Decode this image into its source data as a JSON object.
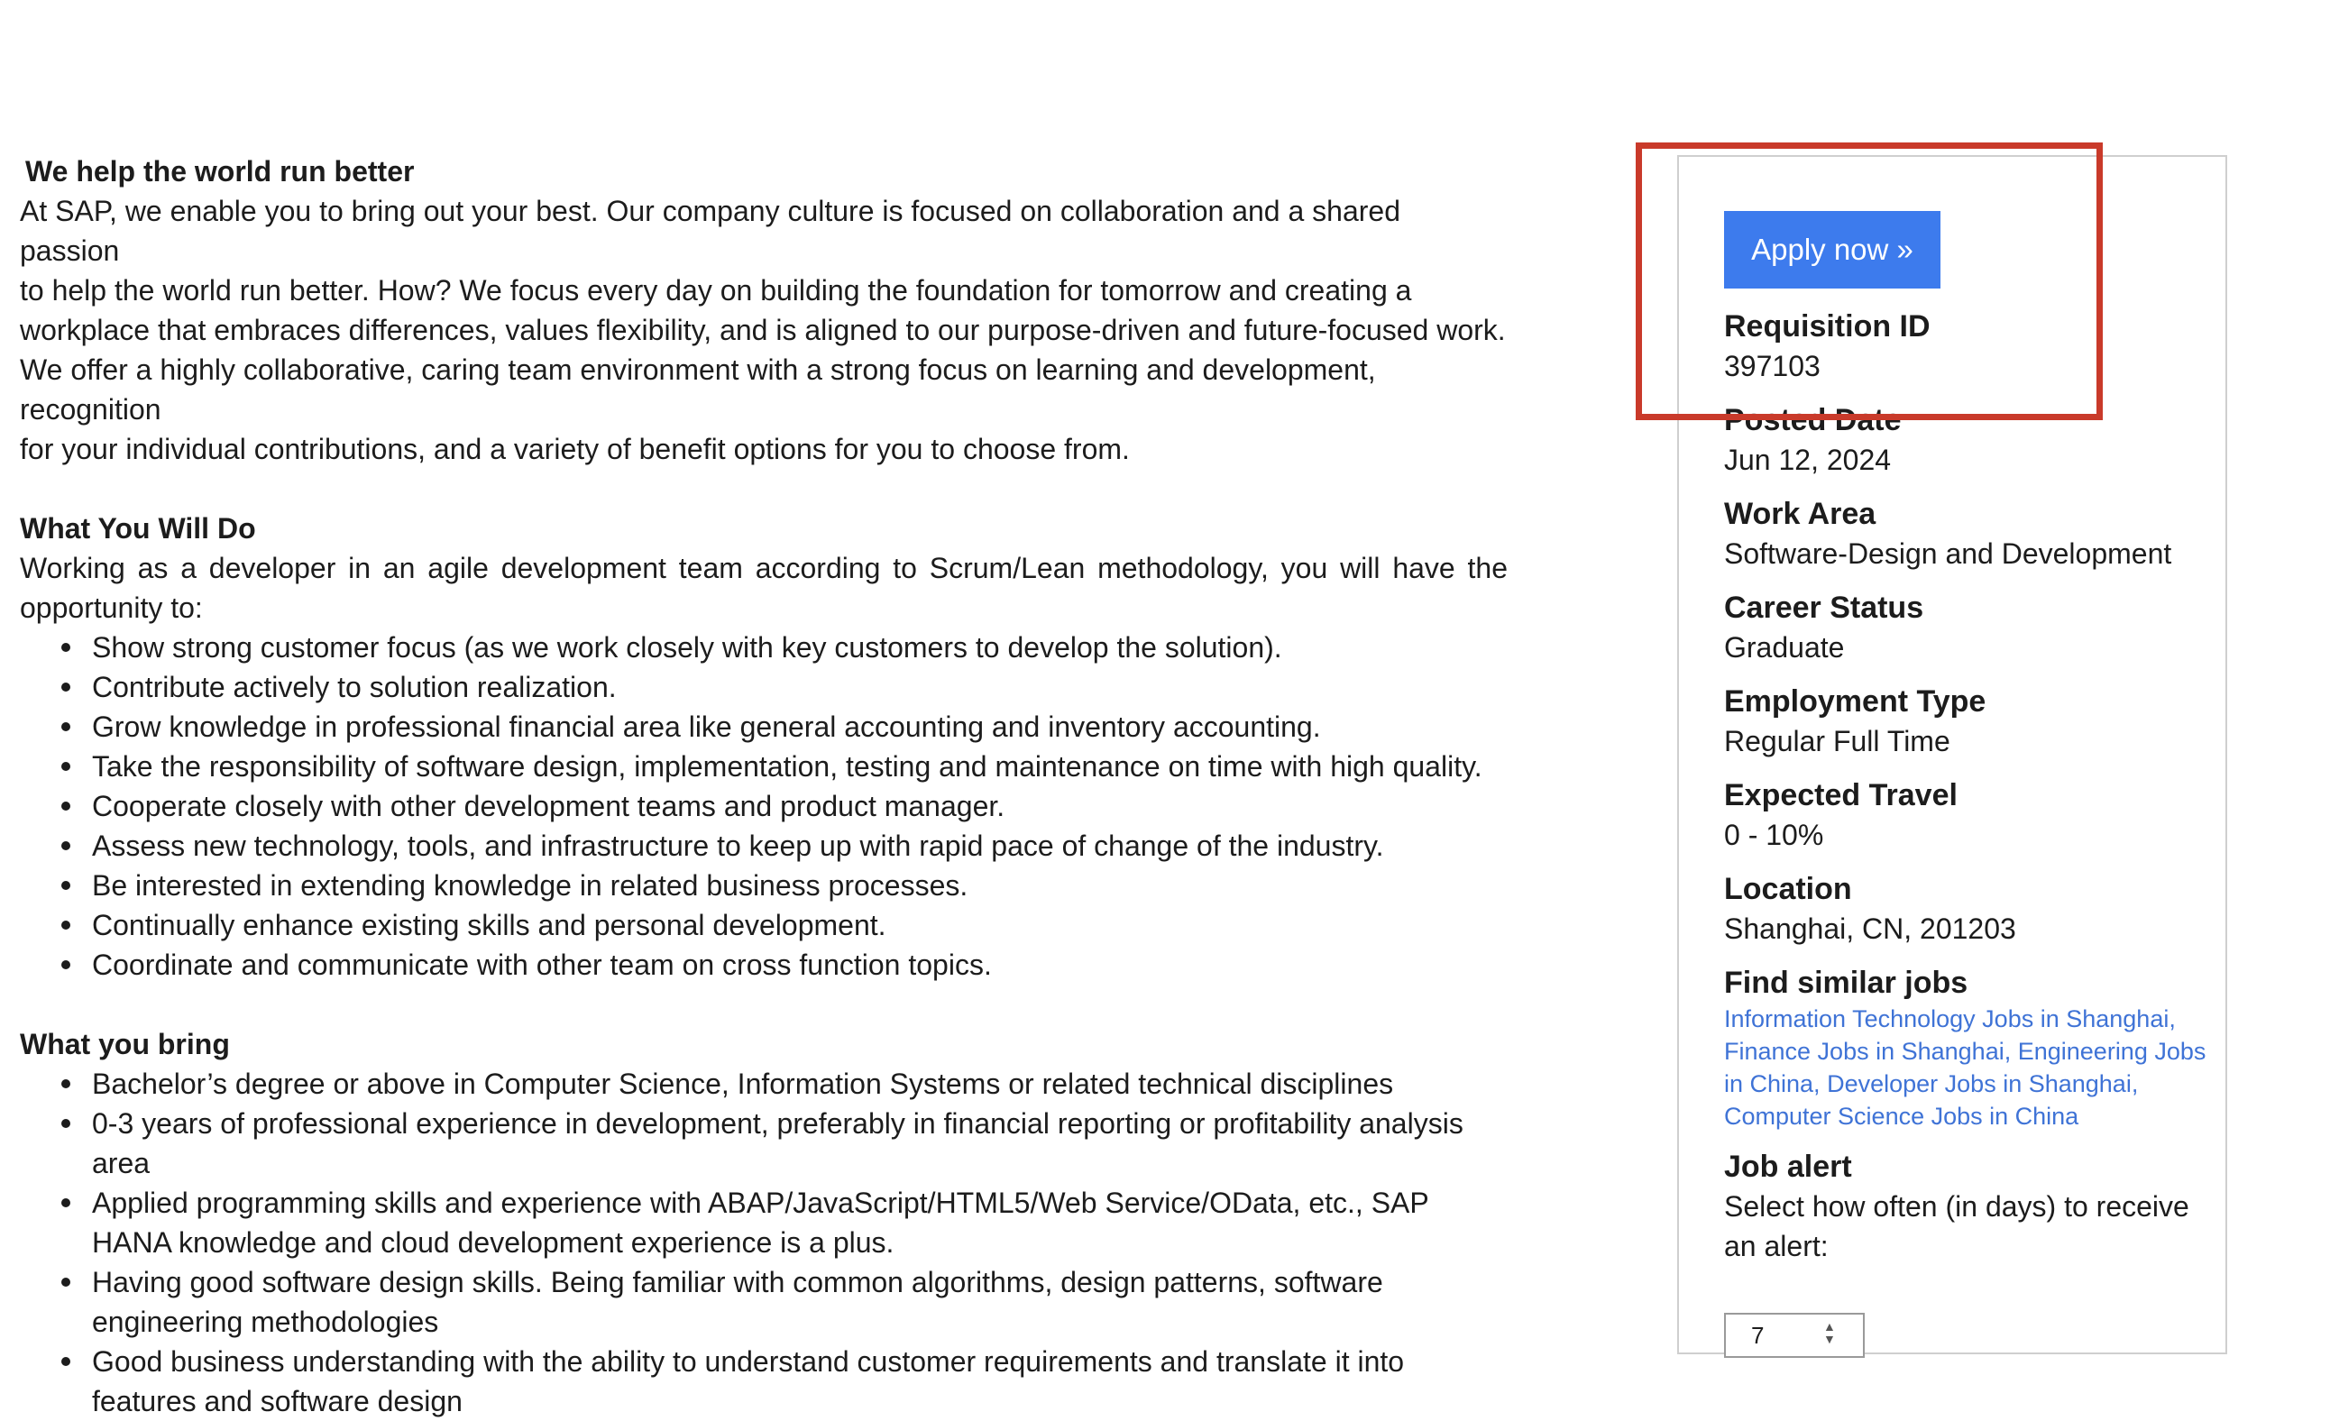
{
  "intro": {
    "heading": "We help the world run better",
    "lines": [
      "At SAP, we enable you to bring out your best. Our company culture is focused on collaboration and a shared passion",
      "to help the world run better. How? We focus every day on building the foundation for tomorrow and creating a",
      "workplace that embraces differences, values flexibility, and is aligned to our purpose-driven and future-focused work.",
      "We offer a highly collaborative, caring team environment with a strong focus on learning and development, recognition",
      "for your individual contributions, and a variety of benefit options for you to choose from."
    ]
  },
  "what_you_do": {
    "heading": "What You Will Do",
    "intro": "Working as a developer in an agile development team according to Scrum/Lean methodology, you will have the opportunity to:",
    "items": [
      "Show strong customer focus (as we work closely with key customers to develop the solution).",
      "Contribute actively to solution realization.",
      "Grow knowledge in professional financial area like general accounting and inventory accounting.",
      "Take the responsibility of software design, implementation, testing and maintenance on time with high quality.",
      "Cooperate closely with other development teams and product manager.",
      "Assess new technology, tools, and infrastructure to keep up with rapid pace of change of the industry.",
      "Be interested in extending knowledge in related business processes.",
      "Continually enhance existing skills and personal development.",
      "Coordinate and communicate with other team on cross function topics."
    ]
  },
  "what_you_bring": {
    "heading": "What you bring",
    "items": [
      "Bachelor’s degree or above in Computer Science, Information Systems or related technical disciplines",
      "0-3 years of professional experience in development, preferably in financial reporting or profitability analysis area",
      "Applied programming skills and experience with ABAP/JavaScript/HTML5/Web Service/OData, etc., SAP HANA knowledge and cloud development experience is a plus.",
      "Having good software design skills. Being familiar with common algorithms, design patterns, software engineering methodologies",
      "Good business understanding with the ability to understand customer requirements and translate it into features and software design"
    ]
  },
  "sidebar": {
    "apply_label": "Apply now »",
    "fields": [
      {
        "label": "Requisition ID",
        "value": "397103"
      },
      {
        "label": "Posted Date",
        "value": "Jun 12, 2024"
      },
      {
        "label": "Work Area",
        "value": "Software-Design and Development"
      },
      {
        "label": "Career Status",
        "value": "Graduate"
      },
      {
        "label": "Employment Type",
        "value": "Regular Full Time"
      },
      {
        "label": "Expected Travel",
        "value": "0 - 10%"
      },
      {
        "label": "Location",
        "value": "Shanghai, CN, 201203"
      }
    ],
    "similar_label": "Find similar jobs",
    "similar_links": [
      "Information Technology Jobs in Shanghai,",
      "Finance Jobs in Shanghai,",
      "Engineering Jobs in China,",
      "Developer Jobs in Shanghai,",
      "Computer Science Jobs in China"
    ],
    "alert_label": "Job alert",
    "alert_text": "Select how often (in days) to receive an alert:",
    "alert_value": "7"
  },
  "colors": {
    "apply_button": "#3d7bed",
    "link": "#3f73d6",
    "highlight_box": "#c93a2a"
  }
}
